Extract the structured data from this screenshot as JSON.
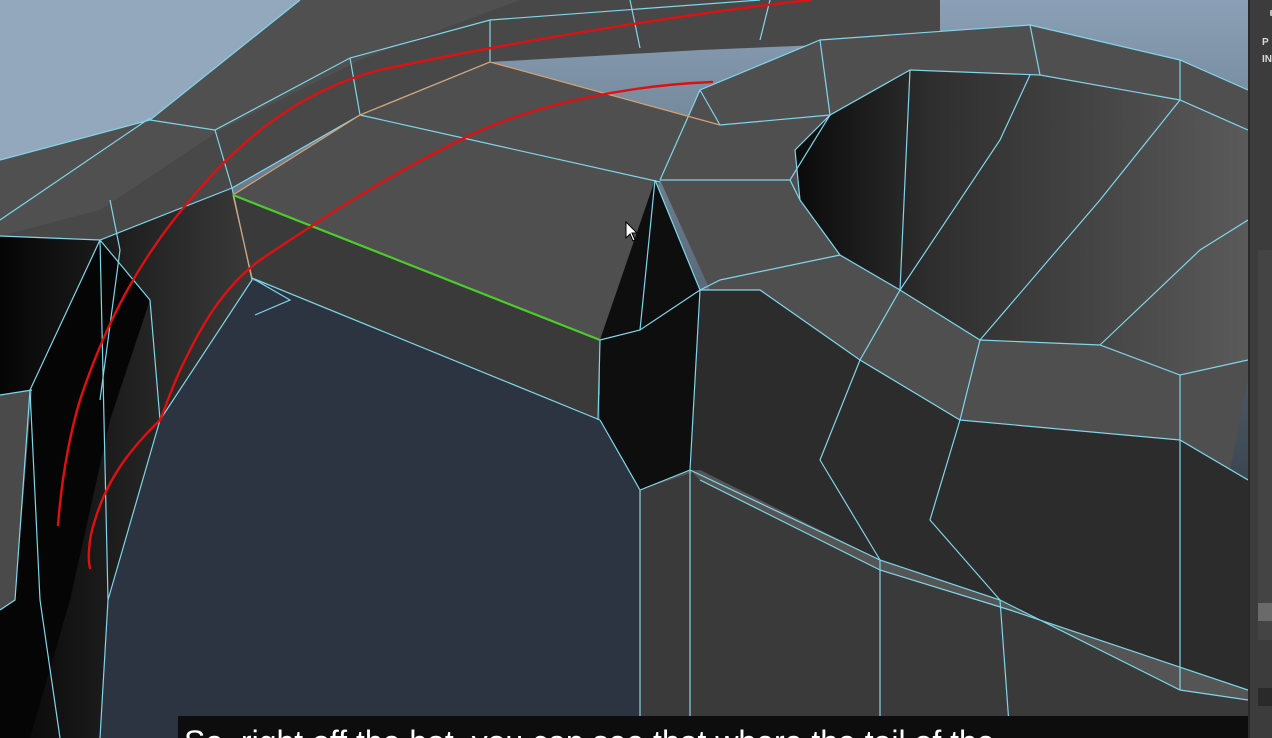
{
  "app": {
    "name": "Maya viewport - polygon modeling"
  },
  "viewport": {
    "mesh": "ring-with-bridge",
    "selection": {
      "edge_color": "#4ccc2c",
      "highlight_face_edges": "#d8a070"
    },
    "wire_color": "#7fd6ea",
    "annotation_color": "#e01010",
    "cursor": "arrow-cursor"
  },
  "side_panel": {
    "line1": "P",
    "line2": "IN"
  },
  "subtitle": {
    "text": "So, right off the bat, you can see that where the tail of the ..."
  }
}
